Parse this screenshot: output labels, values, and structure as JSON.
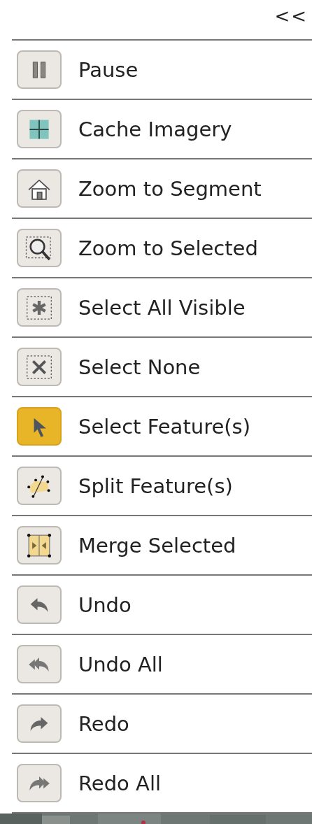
{
  "collapse_button": "<<",
  "items": [
    {
      "label": "Pause",
      "selected": false
    },
    {
      "label": "Cache Imagery",
      "selected": false
    },
    {
      "label": "Zoom to Segment",
      "selected": false
    },
    {
      "label": "Zoom to Selected",
      "selected": false
    },
    {
      "label": "Select All Visible",
      "selected": false
    },
    {
      "label": "Select None",
      "selected": false
    },
    {
      "label": "Select Feature(s)",
      "selected": true
    },
    {
      "label": "Split Feature(s)",
      "selected": false
    },
    {
      "label": "Merge Selected",
      "selected": false
    },
    {
      "label": "Undo",
      "selected": false
    },
    {
      "label": "Undo All",
      "selected": false
    },
    {
      "label": "Redo",
      "selected": false
    },
    {
      "label": "Redo All",
      "selected": false
    }
  ]
}
